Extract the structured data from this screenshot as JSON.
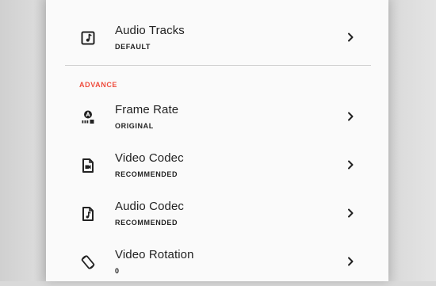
{
  "colors": {
    "accent": "#ef4b3c",
    "text": "#222222",
    "panel_bg": "#fafafa"
  },
  "settings": {
    "audio_tracks": {
      "label": "Audio Tracks",
      "value": "DEFAULT",
      "icon": "music-note-icon"
    },
    "section_advance": "ADVANCE",
    "frame_rate": {
      "label": "Frame Rate",
      "value": "ORIGINAL",
      "icon": "frame-rate-icon"
    },
    "video_codec": {
      "label": "Video Codec",
      "value": "RECOMMENDED",
      "icon": "video-file-icon"
    },
    "audio_codec": {
      "label": "Audio Codec",
      "value": "RECOMMENDED",
      "icon": "audio-file-icon"
    },
    "video_rotation": {
      "label": "Video Rotation",
      "value": "0",
      "icon": "rotate-icon"
    }
  }
}
